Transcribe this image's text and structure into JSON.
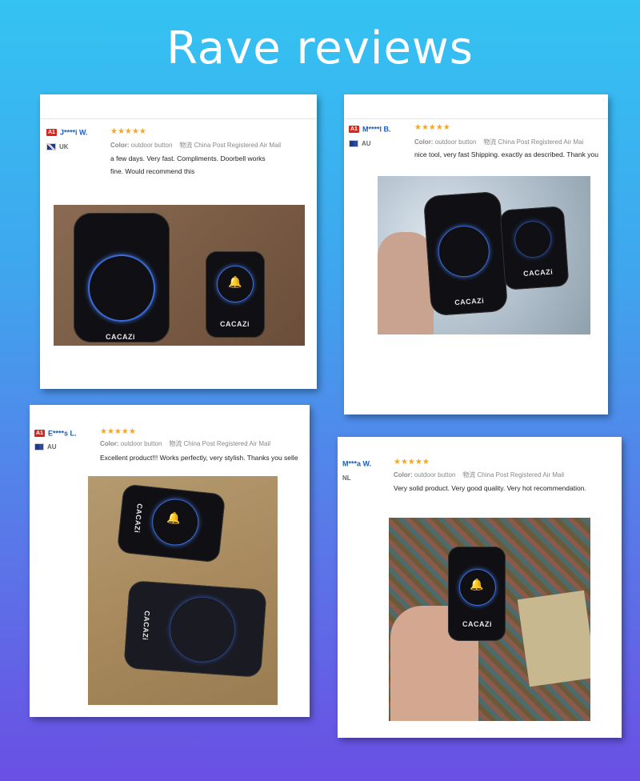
{
  "page": {
    "title": "Rave reviews"
  },
  "reviews": [
    {
      "badge": "A1",
      "name": "J****i W.",
      "country": "UK",
      "stars": "★★★★★",
      "color_label": "Color:",
      "color_value": "outdoor button",
      "shipping_label": "物流",
      "shipping_value": "China Post Registered Air Mail",
      "text_line1": "a few days. Very fast. Compliments. Doorbell works",
      "text_line2": "fine. Would recommend this",
      "photo_logo_1": "CACAZi",
      "photo_logo_2": "CACAZi"
    },
    {
      "badge": "A1",
      "name": "M****l B.",
      "country": "AU",
      "stars": "★★★★★",
      "color_label": "Color:",
      "color_value": "outdoor button",
      "shipping_label": "物流",
      "shipping_value": "China Post Registered Air Mai",
      "text_line1": "nice tool, very fast Shipping. exactly as described. Thank you",
      "photo_logo_1": "CACAZi",
      "photo_logo_2": "CACAZi"
    },
    {
      "badge": "A1",
      "name": "E****s L.",
      "country": "AU",
      "stars": "★★★★★",
      "color_label": "Color:",
      "color_value": "outdoor button",
      "shipping_label": "物流",
      "shipping_value": "China Post Registered Air Mail",
      "text_line1": "Excellent product!!! Works perfectly, very stylish. Thanks you selle",
      "photo_logo_1": "CACAZi",
      "photo_logo_2": "CACAZi"
    },
    {
      "name": "M***a W.",
      "country": "NL",
      "stars": "★★★★★",
      "color_label": "Color:",
      "color_value": "outdoor button",
      "shipping_label": "物流",
      "shipping_value": "China Post Registered Air Mail",
      "text_line1": "Very solid product. Very good quality. Very hot recommendation.",
      "photo_logo_1": "CACAZi"
    }
  ],
  "colors": {
    "accent_name": "#1a5db8",
    "star": "#f5a623",
    "badge": "#d8261c"
  }
}
